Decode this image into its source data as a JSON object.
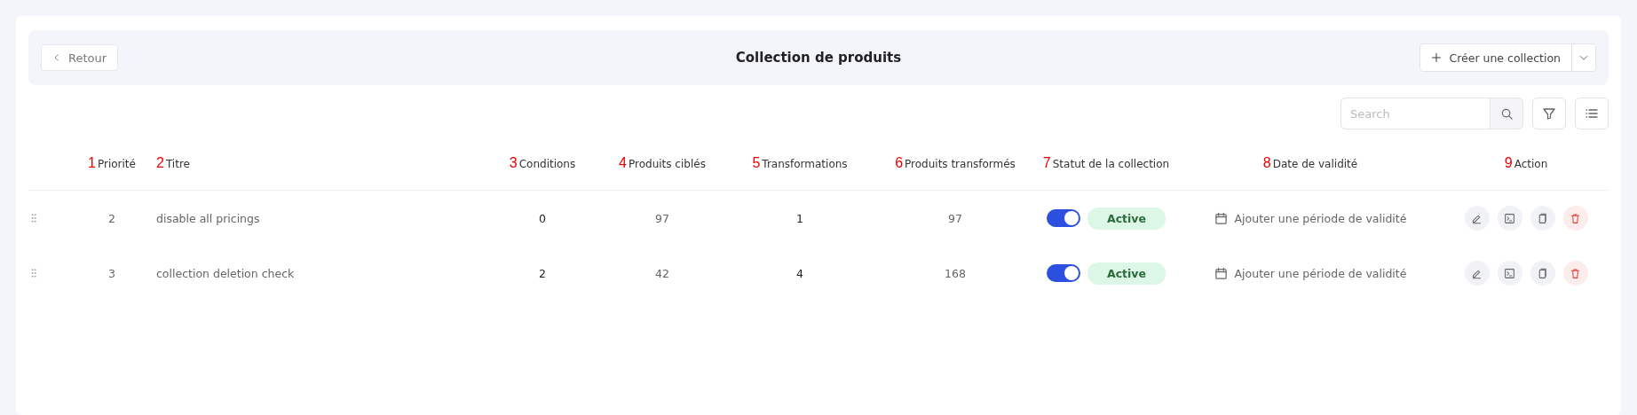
{
  "header": {
    "back_button": "Retour",
    "title": "Collection de produits",
    "create_button": "Créer une collection"
  },
  "search": {
    "placeholder": "Search"
  },
  "table": {
    "columns": [
      {
        "marker": "1",
        "label": "Priorité"
      },
      {
        "marker": "2",
        "label": "Titre"
      },
      {
        "marker": "3",
        "label": "Conditions"
      },
      {
        "marker": "4",
        "label": "Produits ciblés"
      },
      {
        "marker": "5",
        "label": "Transformations"
      },
      {
        "marker": "6",
        "label": "Produits transformés"
      },
      {
        "marker": "7",
        "label": "Statut de la collection"
      },
      {
        "marker": "8",
        "label": "Date de validité"
      },
      {
        "marker": "9",
        "label": "Action"
      }
    ],
    "rows": [
      {
        "priority": "2",
        "title": "disable all pricings",
        "conditions": "0",
        "targeted": "97",
        "transformations": "1",
        "transformed": "97",
        "on": true,
        "status": "Active",
        "validity": "Ajouter une période de validité"
      },
      {
        "priority": "3",
        "title": "collection deletion check",
        "conditions": "2",
        "targeted": "42",
        "transformations": "4",
        "transformed": "168",
        "on": true,
        "status": "Active",
        "validity": "Ajouter une période de validité"
      }
    ]
  }
}
